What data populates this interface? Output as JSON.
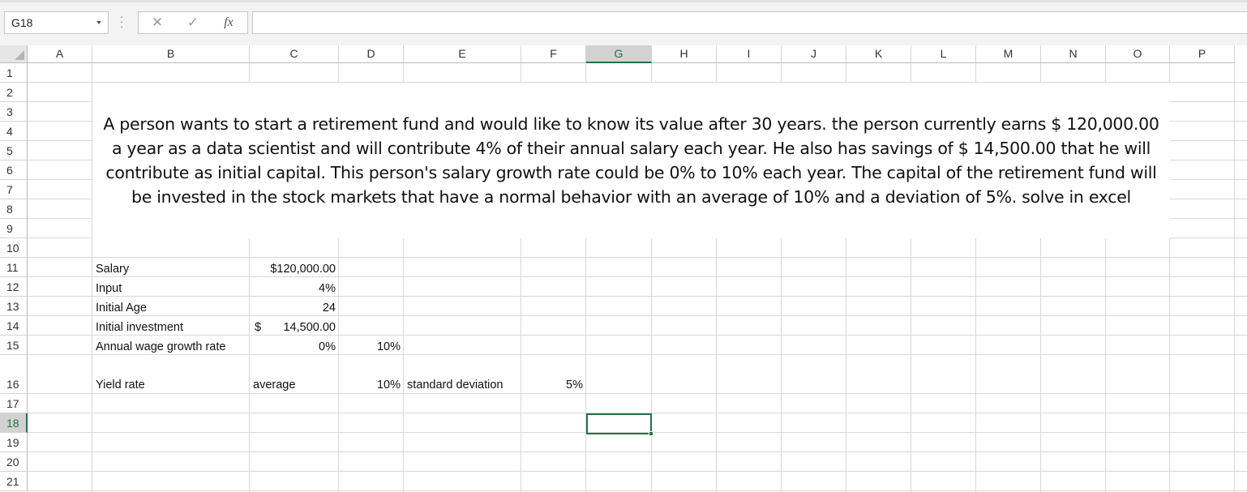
{
  "name_box": {
    "value": "G18"
  },
  "formula_bar": {
    "cancel_glyph": "✕",
    "enter_glyph": "✓",
    "fx_glyph": "fx",
    "content": ""
  },
  "columns": [
    "A",
    "B",
    "C",
    "D",
    "E",
    "F",
    "G",
    "H",
    "I",
    "J",
    "K",
    "L",
    "M",
    "N",
    "O",
    "P"
  ],
  "active_column": "G",
  "rows": [
    "1",
    "2",
    "3",
    "4",
    "5",
    "6",
    "7",
    "8",
    "9",
    "10",
    "11",
    "12",
    "13",
    "14",
    "15",
    "16",
    "17",
    "18",
    "19",
    "20",
    "21"
  ],
  "active_row": "18",
  "problem_text": "A person wants to start a retirement fund and would like to know its value after 30 years. the person currently earns $ 120,000.00 a year as a data scientist and will contribute 4% of their annual salary each year. He also has savings of $ 14,500.00 that he will contribute as initial capital. This person's salary growth rate could be 0% to 10% each year. The capital of the retirement fund will be invested in the stock markets that have a normal behavior with an average of 10% and a deviation of 5%. solve in excel",
  "cells": {
    "B11": "Salary",
    "C11": "$120,000.00",
    "B12": "Input",
    "C12": "4%",
    "B13": "Initial Age",
    "C13": "24",
    "B14": "Initial investment",
    "C14_symbol": "$",
    "C14_value": "14,500.00",
    "B15": "Annual wage growth rate",
    "C15": "0%",
    "D15": "10%",
    "B16": "Yield rate",
    "C16": "average",
    "D16": "10%",
    "E16": "standard deviation",
    "F16": "5%"
  },
  "colors": {
    "accent": "#217346",
    "gridline": "#d9d9d9",
    "header_bg": "#f3f3f3"
  }
}
